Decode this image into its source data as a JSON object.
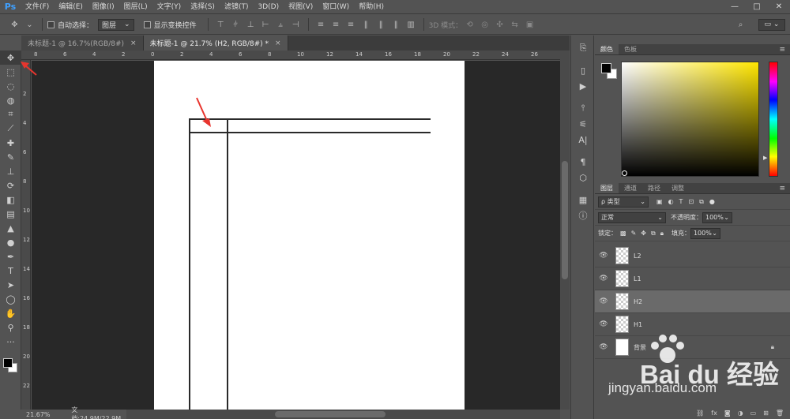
{
  "app": {
    "logo": "Ps"
  },
  "menu": [
    "文件(F)",
    "编辑(E)",
    "图像(I)",
    "图层(L)",
    "文字(Y)",
    "选择(S)",
    "滤镜(T)",
    "3D(D)",
    "视图(V)",
    "窗口(W)",
    "帮助(H)"
  ],
  "window_controls": [
    "—",
    "□",
    "✕"
  ],
  "options": {
    "auto_select_label": "自动选择：",
    "auto_select_value": "图层",
    "show_transform_label": "显示变换控件",
    "mode_3d_label": "3D 模式："
  },
  "tabs": [
    {
      "label": "未标题-1 @ 16.7%(RGB/8#)",
      "close": "×"
    },
    {
      "label": "未标题-1 @ 21.7% (H2, RGB/8#) *",
      "close": "×"
    }
  ],
  "ruler_h": [
    "8",
    "6",
    "4",
    "2",
    "0",
    "2",
    "4",
    "6",
    "8",
    "10",
    "12",
    "14",
    "16",
    "18",
    "20",
    "22",
    "24",
    "26"
  ],
  "ruler_v": [
    "0",
    "2",
    "4",
    "6",
    "8",
    "10",
    "12",
    "14",
    "16",
    "18",
    "20",
    "22"
  ],
  "status": {
    "zoom": "21.67%",
    "doc": "文档:24.9M/22.9M"
  },
  "color_panel": {
    "tabs": [
      "颜色",
      "色板"
    ],
    "fg": "#000000",
    "bg": "#ffffff"
  },
  "layers_panel": {
    "tabs": [
      "图层",
      "通道",
      "路径",
      "调整"
    ],
    "filter_label": "ρ 类型",
    "blend_mode": "正常",
    "opacity_label": "不透明度：",
    "opacity_value": "100%",
    "lock_label": "锁定：",
    "fill_label": "填充：",
    "fill_value": "100%",
    "layers": [
      {
        "name": "L2",
        "selected": false,
        "background": false
      },
      {
        "name": "L1",
        "selected": false,
        "background": false
      },
      {
        "name": "H2",
        "selected": true,
        "background": false
      },
      {
        "name": "H1",
        "selected": false,
        "background": false
      },
      {
        "name": "背景",
        "selected": false,
        "background": true
      }
    ],
    "footer_icons": [
      "link-icon",
      "fx-icon",
      "mask-icon",
      "adjustment-icon",
      "group-icon",
      "new-layer-icon",
      "trash-icon"
    ]
  },
  "watermark": {
    "brand": "Bai du 经验",
    "url": "jingyan.baidu.com"
  },
  "colors": {
    "accent": "#3fa0ff",
    "arrow": "#e8352e"
  }
}
